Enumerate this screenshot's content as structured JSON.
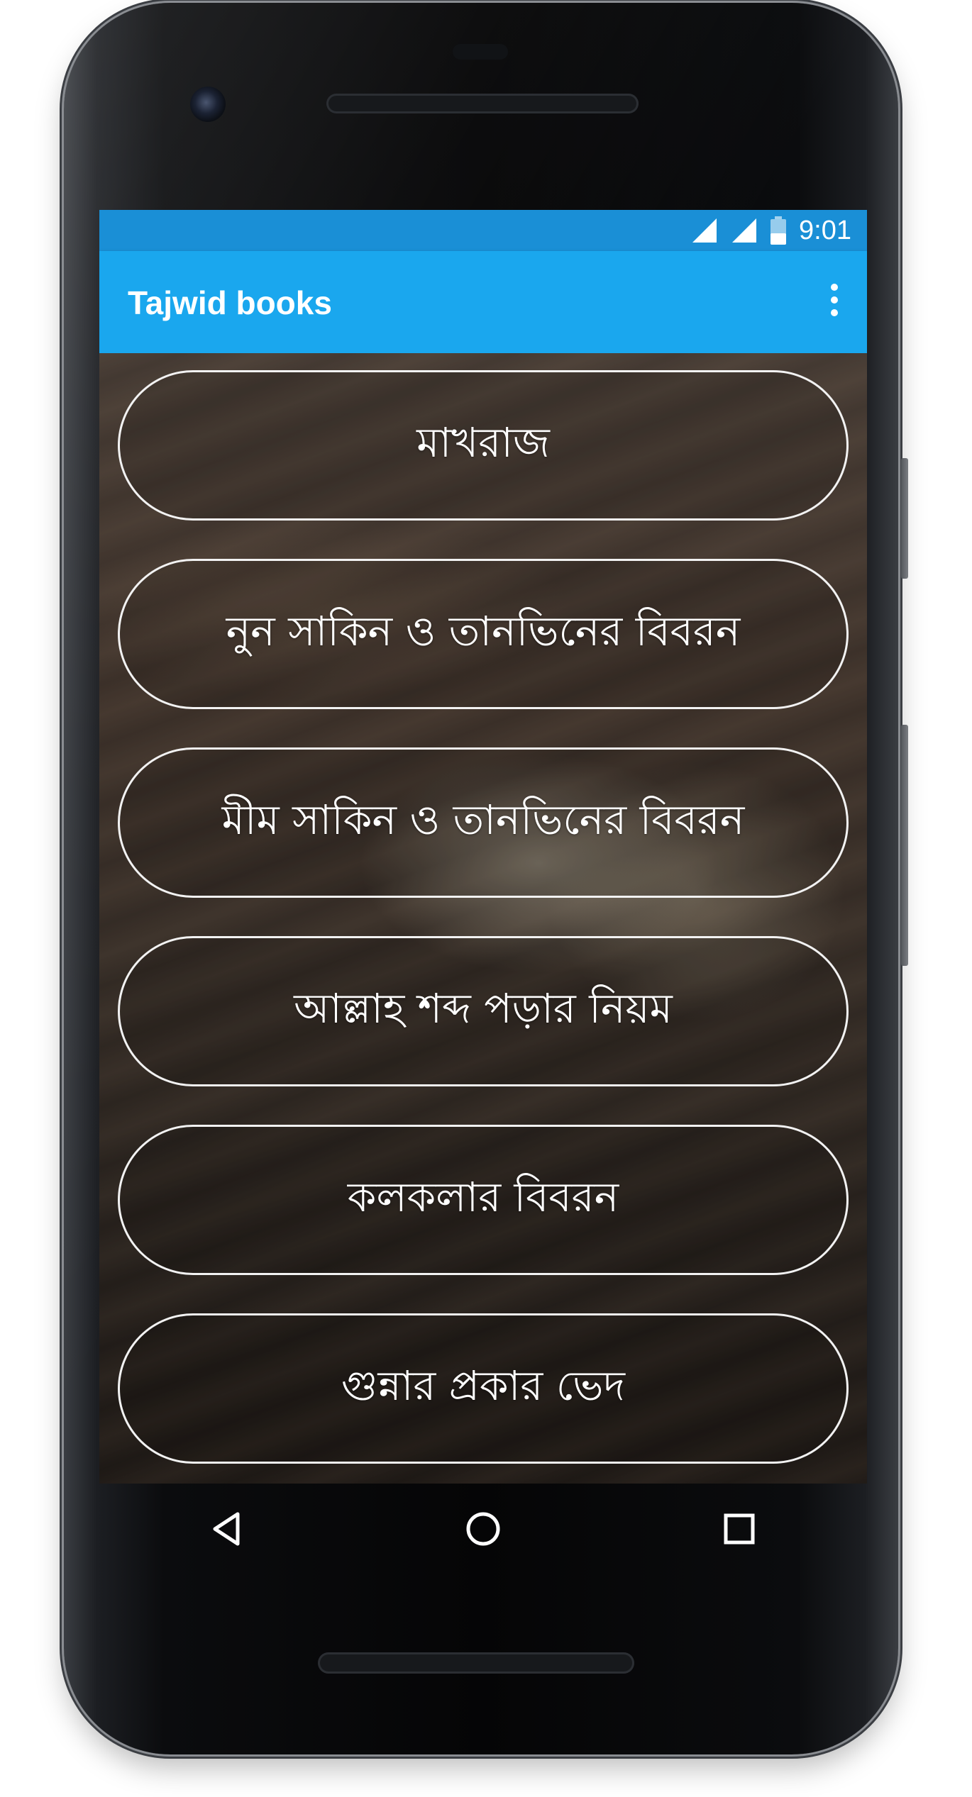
{
  "status_bar": {
    "time": "9:01",
    "icons": [
      "signal-icon",
      "signal-icon",
      "battery-icon"
    ]
  },
  "app_bar": {
    "title": "Tajwid books",
    "overflow_icon": "more-vert-icon"
  },
  "menu": {
    "items": [
      {
        "label": "মাখরাজ"
      },
      {
        "label": "নুন সাকিন ও তানভিনের বিবরন"
      },
      {
        "label": "মীম সাকিন ও তানভিনের বিবরন"
      },
      {
        "label": "আল্লাহ শব্দ পড়ার নিয়ম"
      },
      {
        "label": "কলকলার বিবরন"
      },
      {
        "label": "গুন্নার প্রকার ভেদ"
      }
    ]
  },
  "nav_bar": {
    "buttons": [
      "back-icon",
      "home-icon",
      "recents-icon"
    ]
  },
  "colors": {
    "status_bar": "#1a8fd6",
    "app_bar": "#1aa7ee",
    "button_border": "#f2f2f2"
  }
}
